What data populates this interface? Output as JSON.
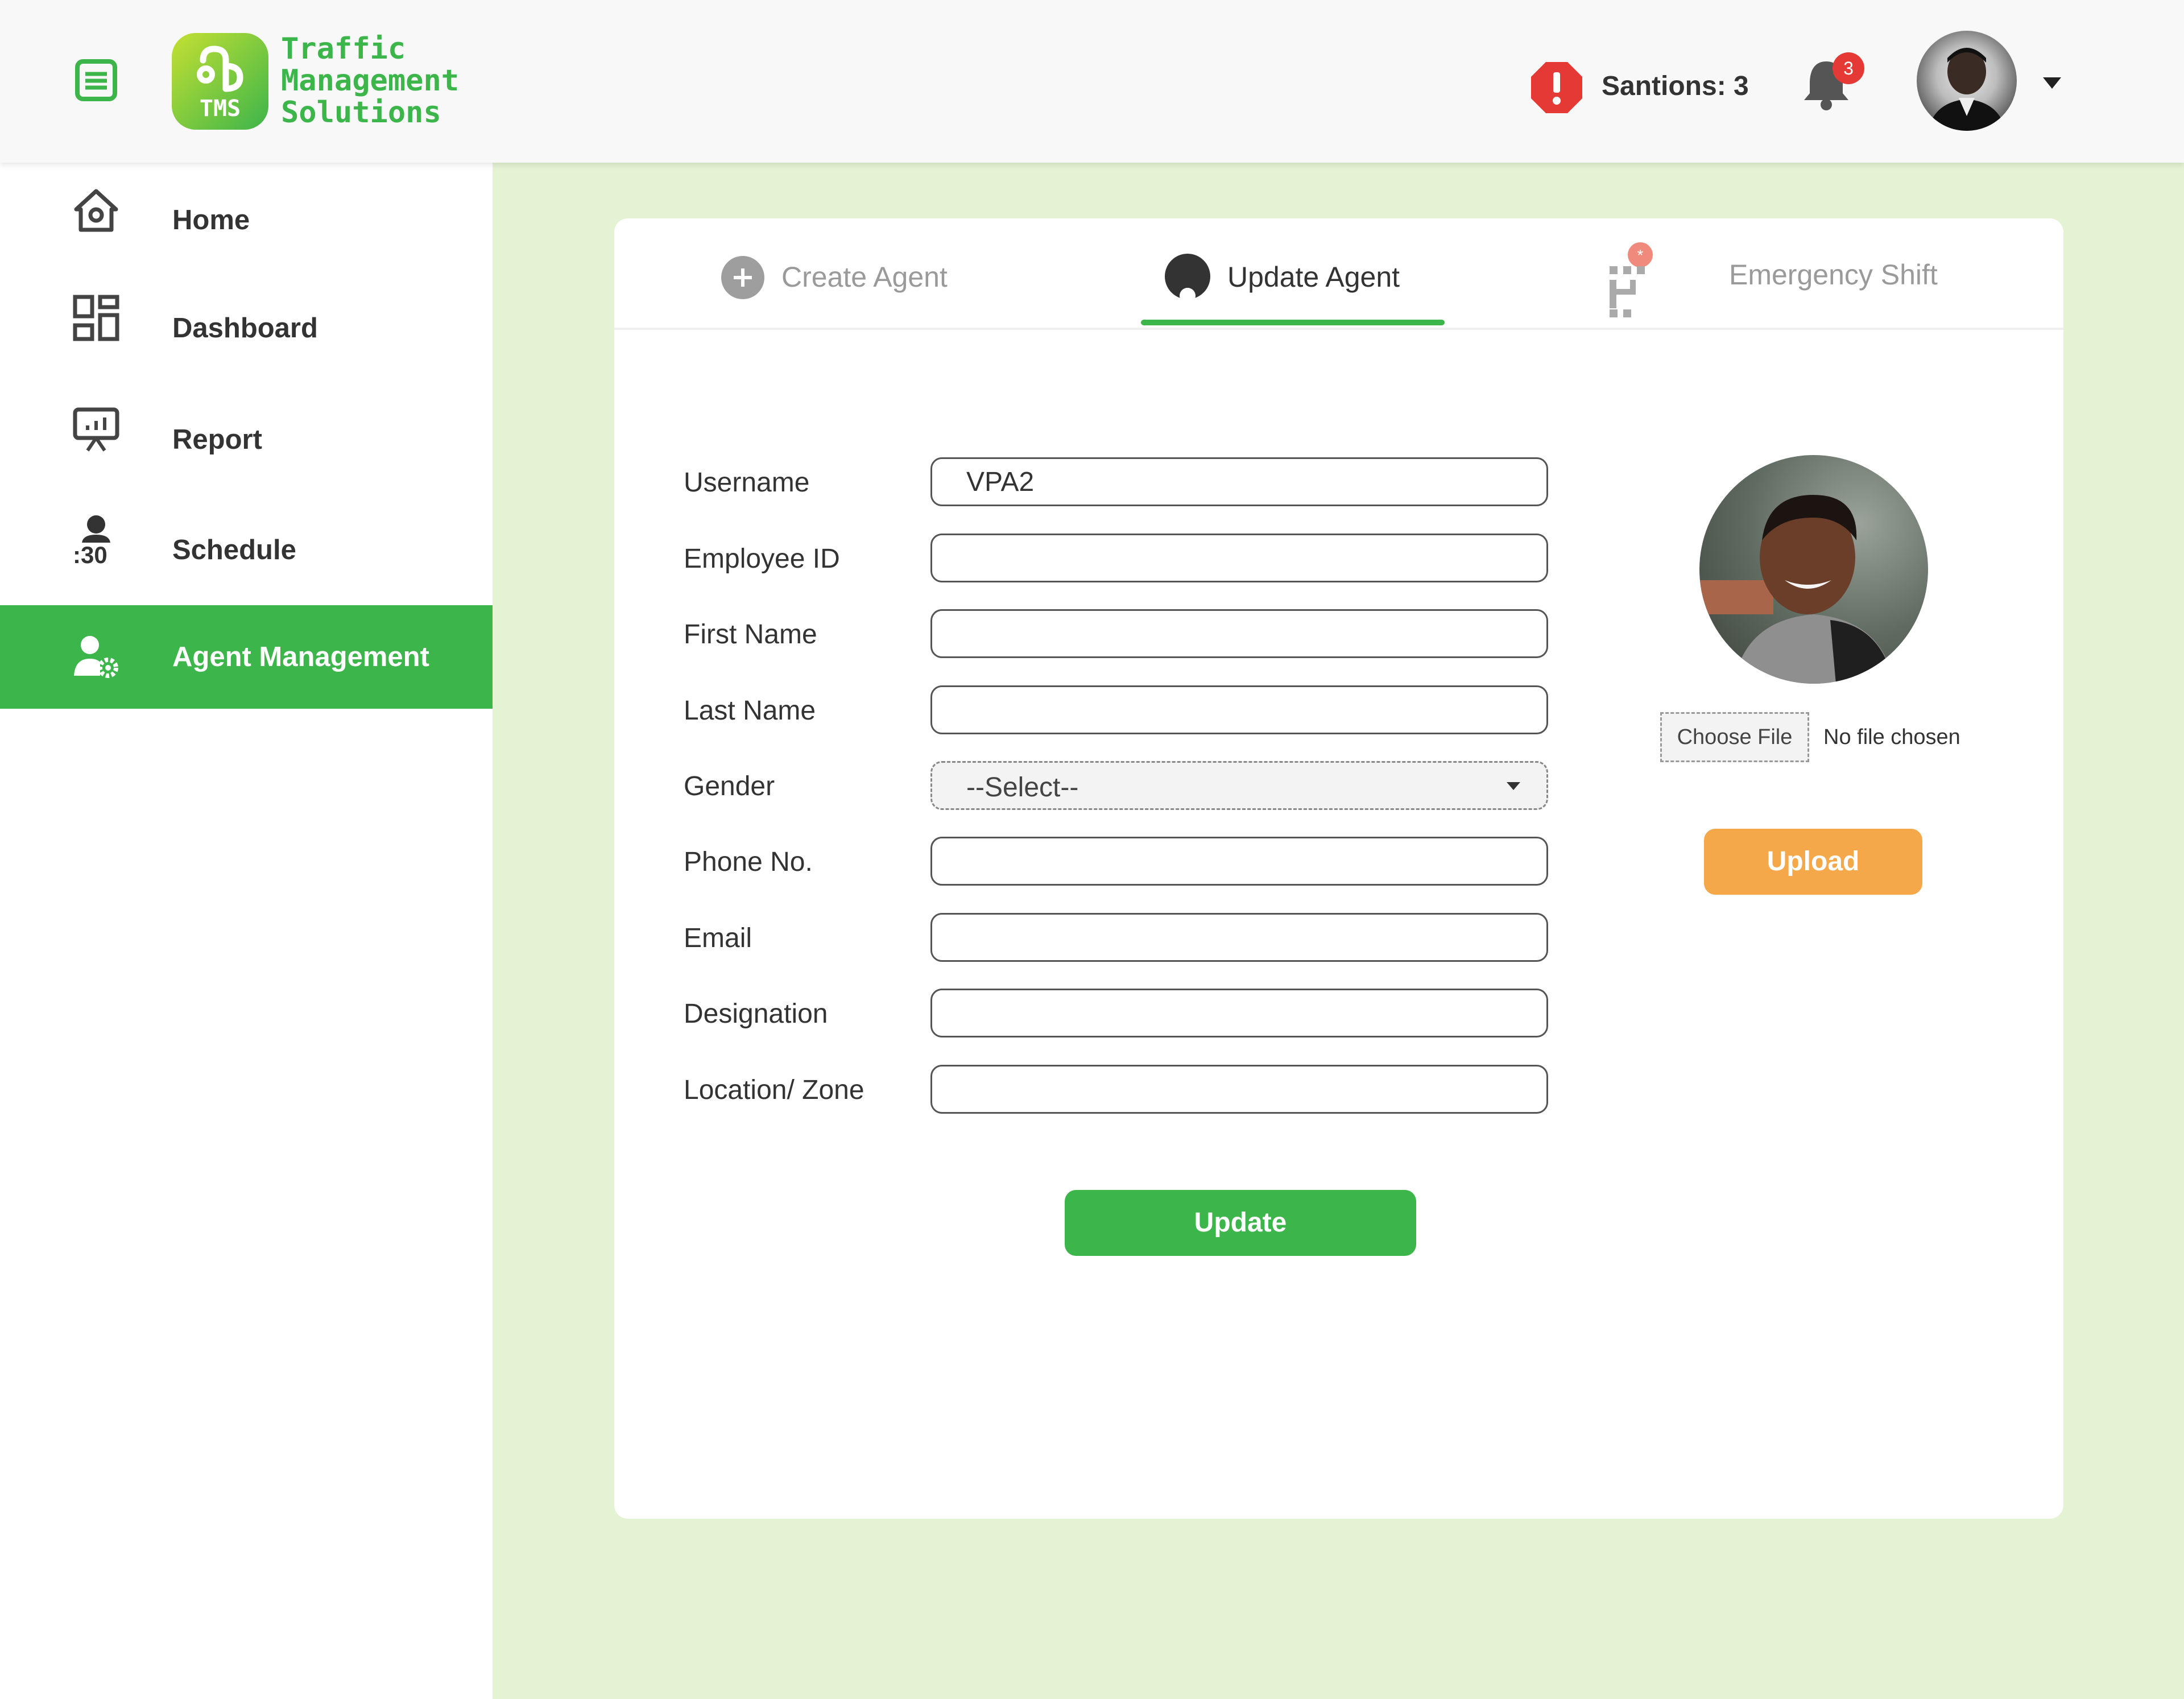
{
  "header": {
    "logo_badge": "TMS",
    "brand_lines": [
      "Traffic",
      "Management",
      "Solutions"
    ],
    "sanctions_label": "Santions: 3",
    "notification_count": "3"
  },
  "sidebar": {
    "items": [
      {
        "label": "Home",
        "icon": "home-icon"
      },
      {
        "label": "Dashboard",
        "icon": "dashboard-icon"
      },
      {
        "label": "Report",
        "icon": "report-icon"
      },
      {
        "label": "Schedule",
        "icon": "schedule-icon",
        "icon_text": ":30"
      },
      {
        "label": "Agent Management",
        "icon": "agent-management-icon",
        "active": true
      }
    ]
  },
  "tabs": [
    {
      "label": "Create Agent",
      "icon": "plus-circle-icon"
    },
    {
      "label": "Update Agent",
      "icon": "user-circle-icon",
      "active": true
    },
    {
      "label": "Emergency Shift",
      "icon": "emergency-shift-icon"
    }
  ],
  "form": {
    "fields": [
      {
        "label": "Username",
        "value": "VPA2"
      },
      {
        "label": "Employee ID",
        "value": ""
      },
      {
        "label": "First Name",
        "value": ""
      },
      {
        "label": "Last Name",
        "value": ""
      },
      {
        "label": "Gender",
        "value": "--Select--"
      },
      {
        "label": "Phone No.",
        "value": ""
      },
      {
        "label": "Email",
        "value": ""
      },
      {
        "label": "Designation",
        "value": ""
      },
      {
        "label": "Location/ Zone",
        "value": ""
      }
    ],
    "update_label": "Update"
  },
  "photo": {
    "choose_file_label": "Choose File",
    "file_status": "No file chosen",
    "upload_label": "Upload"
  },
  "colors": {
    "brand_green": "#3cb54a",
    "background": "#e4f3d3",
    "upload_orange": "#f5a84a",
    "alert_red": "#e53935"
  }
}
